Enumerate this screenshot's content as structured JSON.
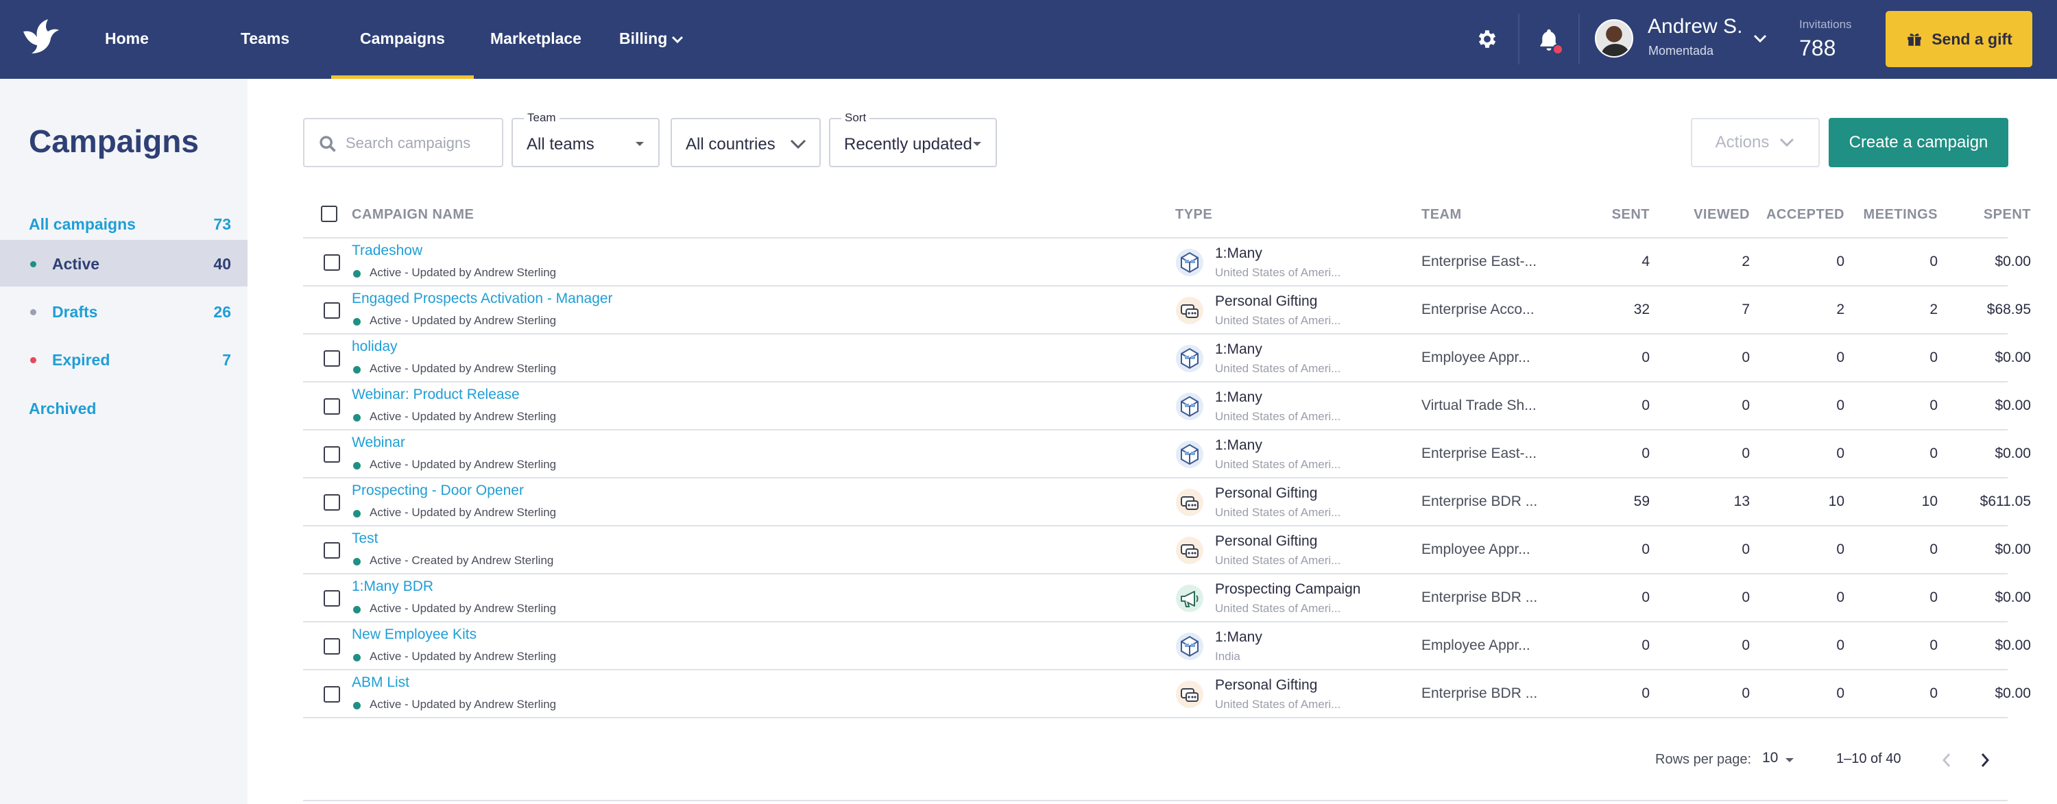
{
  "nav": {
    "items": [
      {
        "label": "Home"
      },
      {
        "label": "Teams"
      },
      {
        "label": "Campaigns"
      },
      {
        "label": "Marketplace"
      },
      {
        "label": "Billing"
      }
    ],
    "active": "Campaigns"
  },
  "user": {
    "name": "Andrew S.",
    "org": "Momentada",
    "invitations_label": "Invitations",
    "invitations_count": "788"
  },
  "gift_button": {
    "label": "Send a gift"
  },
  "sidebar": {
    "title": "Campaigns",
    "items": [
      {
        "label": "All campaigns",
        "count": "73"
      },
      {
        "label": "Active",
        "count": "40",
        "dot_color": "#1f9083"
      },
      {
        "label": "Drafts",
        "count": "26",
        "dot_color": "#9aa0b4"
      },
      {
        "label": "Expired",
        "count": "7",
        "dot_color": "#e7475e"
      },
      {
        "label": "Archived"
      }
    ]
  },
  "filters": {
    "search_placeholder": "Search campaigns",
    "team_legend": "Team",
    "team_value": "All teams",
    "country_value": "All countries",
    "sort_legend": "Sort",
    "sort_value": "Recently updated"
  },
  "actions": {
    "label": "Actions",
    "create_label": "Create a campaign"
  },
  "table": {
    "headers": {
      "name": "CAMPAIGN NAME",
      "type": "TYPE",
      "team": "TEAM",
      "sent": "SENT",
      "viewed": "VIEWED",
      "accepted": "ACCEPTED",
      "meetings": "MEETINGS",
      "spent": "SPENT"
    },
    "rows": [
      {
        "name": "Tradeshow",
        "status": "Active - Updated by Andrew Sterling",
        "type": "1:Many",
        "country": "United States of Ameri...",
        "team": "Enterprise East-...",
        "sent": "4",
        "viewed": "2",
        "accepted": "0",
        "meetings": "0",
        "spent": "$0.00",
        "icon": "one-to-many-icon"
      },
      {
        "name": "Engaged Prospects Activation - Manager",
        "status": "Active - Updated by Andrew Sterling",
        "type": "Personal Gifting",
        "country": "United States of Ameri...",
        "team": "Enterprise Acco...",
        "sent": "32",
        "viewed": "7",
        "accepted": "2",
        "meetings": "2",
        "spent": "$68.95",
        "icon": "personal-gifting-icon"
      },
      {
        "name": "holiday",
        "status": "Active - Updated by Andrew Sterling",
        "type": "1:Many",
        "country": "United States of Ameri...",
        "team": "Employee Appr...",
        "sent": "0",
        "viewed": "0",
        "accepted": "0",
        "meetings": "0",
        "spent": "$0.00",
        "icon": "one-to-many-icon"
      },
      {
        "name": "Webinar: Product Release",
        "status": "Active - Updated by Andrew Sterling",
        "type": "1:Many",
        "country": "United States of Ameri...",
        "team": "Virtual Trade Sh...",
        "sent": "0",
        "viewed": "0",
        "accepted": "0",
        "meetings": "0",
        "spent": "$0.00",
        "icon": "one-to-many-icon"
      },
      {
        "name": "Webinar",
        "status": "Active - Updated by Andrew Sterling",
        "type": "1:Many",
        "country": "United States of Ameri...",
        "team": "Enterprise East-...",
        "sent": "0",
        "viewed": "0",
        "accepted": "0",
        "meetings": "0",
        "spent": "$0.00",
        "icon": "one-to-many-icon"
      },
      {
        "name": "Prospecting - Door Opener",
        "status": "Active - Updated by Andrew Sterling",
        "type": "Personal Gifting",
        "country": "United States of Ameri...",
        "team": "Enterprise BDR ...",
        "sent": "59",
        "viewed": "13",
        "accepted": "10",
        "meetings": "10",
        "spent": "$611.05",
        "icon": "personal-gifting-icon"
      },
      {
        "name": "Test",
        "status": "Active - Created by Andrew Sterling",
        "type": "Personal Gifting",
        "country": "United States of Ameri...",
        "team": "Employee Appr...",
        "sent": "0",
        "viewed": "0",
        "accepted": "0",
        "meetings": "0",
        "spent": "$0.00",
        "icon": "personal-gifting-icon"
      },
      {
        "name": "1:Many BDR",
        "status": "Active - Updated by Andrew Sterling",
        "type": "Prospecting Campaign",
        "country": "United States of Ameri...",
        "team": "Enterprise BDR ...",
        "sent": "0",
        "viewed": "0",
        "accepted": "0",
        "meetings": "0",
        "spent": "$0.00",
        "icon": "prospecting-megaphone-icon"
      },
      {
        "name": "New Employee Kits",
        "status": "Active - Updated by Andrew Sterling",
        "type": "1:Many",
        "country": "India",
        "team": "Employee Appr...",
        "sent": "0",
        "viewed": "0",
        "accepted": "0",
        "meetings": "0",
        "spent": "$0.00",
        "icon": "one-to-many-icon"
      },
      {
        "name": "ABM List",
        "status": "Active - Updated by Andrew Sterling",
        "type": "Personal Gifting",
        "country": "United States of Ameri...",
        "team": "Enterprise BDR ...",
        "sent": "0",
        "viewed": "0",
        "accepted": "0",
        "meetings": "0",
        "spent": "$0.00",
        "icon": "personal-gifting-icon"
      }
    ]
  },
  "pagination": {
    "rows_per_page_label": "Rows per page:",
    "rows_per_page": "10",
    "range": "1–10 of 40"
  },
  "colors": {
    "topbar": "#2e4075",
    "accent_yellow": "#f3c230",
    "link_blue": "#1f9ed6",
    "primary_green": "#1f9083"
  }
}
